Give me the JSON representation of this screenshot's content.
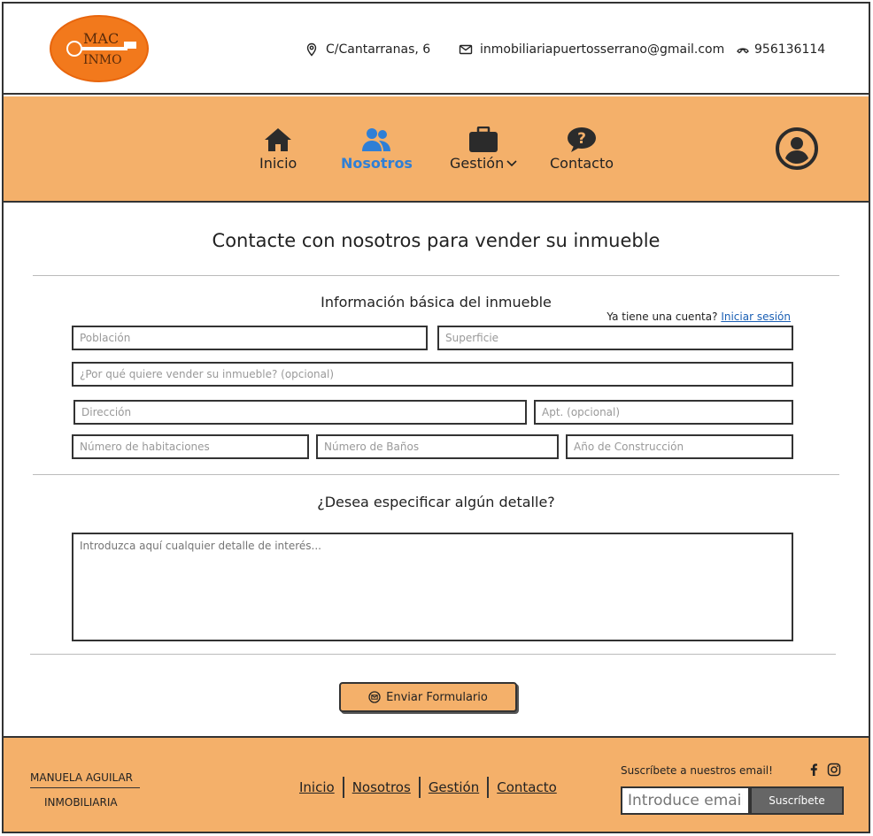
{
  "header": {
    "logo": {
      "line1": "MAC",
      "line2": "INMO"
    },
    "address": "C/Cantarranas, 6",
    "email": "inmobiliariapuertosserrano@gmail.com",
    "phone": "956136114"
  },
  "nav": {
    "items": [
      {
        "label": "Inicio",
        "icon": "home-icon"
      },
      {
        "label": "Nosotros",
        "icon": "users-icon",
        "active": true
      },
      {
        "label": "Gestión",
        "icon": "briefcase-icon"
      },
      {
        "label": "Contacto",
        "icon": "question-icon"
      }
    ],
    "accent": "#2f7fd6",
    "background": "#f4b06a"
  },
  "main": {
    "title": "Contacte con nosotros para vender su inmueble",
    "section1_title": "Información básica del inmueble",
    "login_hint": "Ya tiene una cuenta?",
    "login_link": "Iniciar sesión",
    "fields": {
      "poblacion": "Población",
      "superficie": "Superficie",
      "motivo": "¿Por qué quiere vender su inmueble? (opcional)",
      "direccion": "Dirección",
      "apt": "Apt. (opcional)",
      "habitaciones": "Número de habitaciones",
      "banos": "Número de Baños",
      "construccion": "Año de Construcción"
    },
    "section2_title": "¿Desea especificar algún detalle?",
    "details_placeholder": "Introduzca aquí cualquier detalle de interés...",
    "submit_label": "Enviar Formulario"
  },
  "footer": {
    "brand_line1": "MANUELA AGUILAR",
    "brand_line2": "INMOBILIARIA",
    "links": [
      "Inicio",
      "Nosotros",
      "Gestión",
      "Contacto"
    ],
    "subscribe_label": "Suscríbete a nuestros email!",
    "subscribe_placeholder": "Introduce email",
    "subscribe_button": "Suscríbete"
  }
}
